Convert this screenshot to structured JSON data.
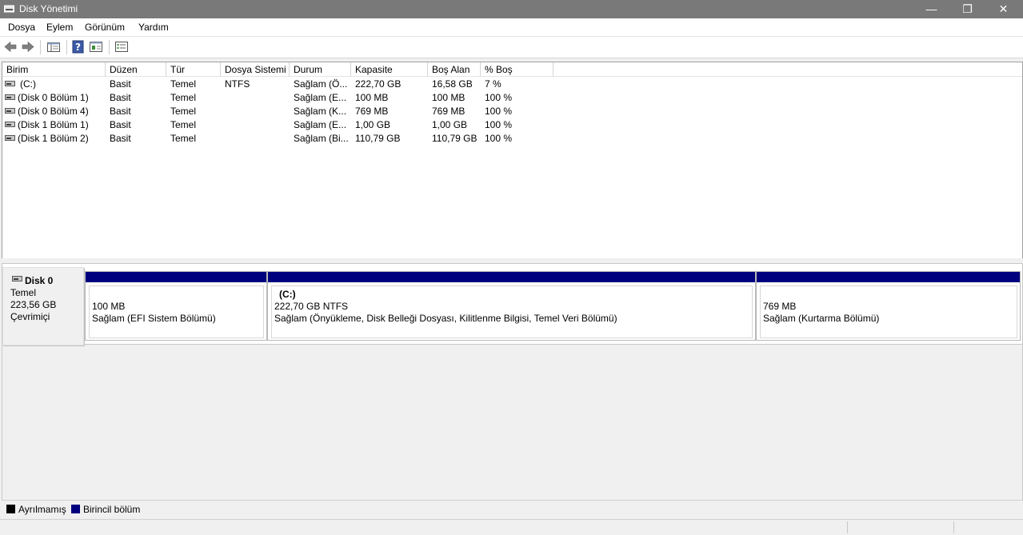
{
  "window": {
    "title": "Disk Yönetimi",
    "minimize": "—",
    "restore": "❐",
    "close": "✕"
  },
  "menu": [
    "Dosya",
    "Eylem",
    "Görünüm",
    "Yardım"
  ],
  "toolbar": {
    "icons": [
      "back-arrow-icon",
      "forward-arrow-icon",
      "console-tree-icon",
      "help-icon",
      "properties-icon",
      "list-view-icon"
    ]
  },
  "volume_list": {
    "columns": [
      "Birim",
      "Düzen",
      "Tür",
      "Dosya Sistemi",
      "Durum",
      "Kapasite",
      "Boş Alan",
      "% Boş"
    ],
    "rows": [
      [
        "(C:)",
        "Basit",
        "Temel",
        "NTFS",
        "Sağlam (Ö...",
        "222,70 GB",
        "16,58 GB",
        "7 %"
      ],
      [
        "(Disk 0 Bölüm 1)",
        "Basit",
        "Temel",
        "",
        "Sağlam (E...",
        "100 MB",
        "100 MB",
        "100 %"
      ],
      [
        "(Disk 0 Bölüm 4)",
        "Basit",
        "Temel",
        "",
        "Sağlam (K...",
        "769 MB",
        "769 MB",
        "100 %"
      ],
      [
        "(Disk 1 Bölüm 1)",
        "Basit",
        "Temel",
        "",
        "Sağlam (E...",
        "1,00 GB",
        "1,00 GB",
        "100 %"
      ],
      [
        "(Disk 1 Bölüm 2)",
        "Basit",
        "Temel",
        "",
        "Sağlam (Bi...",
        "110,79 GB",
        "110,79 GB",
        "100 %"
      ]
    ]
  },
  "disk0": {
    "name": "Disk 0",
    "type": "Temel",
    "size": "223,56 GB",
    "status": "Çevrimiçi",
    "partitions": [
      {
        "title": "",
        "size": "100 MB",
        "status": "Sağlam (EFI Sistem Bölümü)"
      },
      {
        "title": "(C:)",
        "size": "222,70 GB NTFS",
        "status": "Sağlam (Önyükleme, Disk Belleği Dosyası, Kilitlenme Bilgisi, Temel Veri Bölümü)"
      },
      {
        "title": "",
        "size": "769 MB",
        "status": "Sağlam (Kurtarma Bölümü)"
      }
    ]
  },
  "legend": {
    "unallocated": "Ayrılmamış",
    "primary": "Birincil bölüm"
  },
  "colors": {
    "title_bar": "#797979",
    "primary_partition": "#00007e",
    "unallocated": "#000000"
  }
}
